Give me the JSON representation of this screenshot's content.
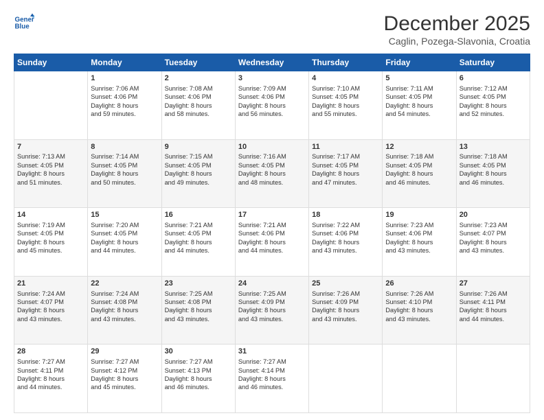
{
  "header": {
    "logo_line1": "General",
    "logo_line2": "Blue",
    "title": "December 2025",
    "subtitle": "Caglin, Pozega-Slavonia, Croatia"
  },
  "weekdays": [
    "Sunday",
    "Monday",
    "Tuesday",
    "Wednesday",
    "Thursday",
    "Friday",
    "Saturday"
  ],
  "weeks": [
    [
      {
        "day": null,
        "info": null
      },
      {
        "day": "1",
        "info": "Sunrise: 7:06 AM\nSunset: 4:06 PM\nDaylight: 8 hours\nand 59 minutes."
      },
      {
        "day": "2",
        "info": "Sunrise: 7:08 AM\nSunset: 4:06 PM\nDaylight: 8 hours\nand 58 minutes."
      },
      {
        "day": "3",
        "info": "Sunrise: 7:09 AM\nSunset: 4:06 PM\nDaylight: 8 hours\nand 56 minutes."
      },
      {
        "day": "4",
        "info": "Sunrise: 7:10 AM\nSunset: 4:05 PM\nDaylight: 8 hours\nand 55 minutes."
      },
      {
        "day": "5",
        "info": "Sunrise: 7:11 AM\nSunset: 4:05 PM\nDaylight: 8 hours\nand 54 minutes."
      },
      {
        "day": "6",
        "info": "Sunrise: 7:12 AM\nSunset: 4:05 PM\nDaylight: 8 hours\nand 52 minutes."
      }
    ],
    [
      {
        "day": "7",
        "info": "Sunrise: 7:13 AM\nSunset: 4:05 PM\nDaylight: 8 hours\nand 51 minutes."
      },
      {
        "day": "8",
        "info": "Sunrise: 7:14 AM\nSunset: 4:05 PM\nDaylight: 8 hours\nand 50 minutes."
      },
      {
        "day": "9",
        "info": "Sunrise: 7:15 AM\nSunset: 4:05 PM\nDaylight: 8 hours\nand 49 minutes."
      },
      {
        "day": "10",
        "info": "Sunrise: 7:16 AM\nSunset: 4:05 PM\nDaylight: 8 hours\nand 48 minutes."
      },
      {
        "day": "11",
        "info": "Sunrise: 7:17 AM\nSunset: 4:05 PM\nDaylight: 8 hours\nand 47 minutes."
      },
      {
        "day": "12",
        "info": "Sunrise: 7:18 AM\nSunset: 4:05 PM\nDaylight: 8 hours\nand 46 minutes."
      },
      {
        "day": "13",
        "info": "Sunrise: 7:18 AM\nSunset: 4:05 PM\nDaylight: 8 hours\nand 46 minutes."
      }
    ],
    [
      {
        "day": "14",
        "info": "Sunrise: 7:19 AM\nSunset: 4:05 PM\nDaylight: 8 hours\nand 45 minutes."
      },
      {
        "day": "15",
        "info": "Sunrise: 7:20 AM\nSunset: 4:05 PM\nDaylight: 8 hours\nand 44 minutes."
      },
      {
        "day": "16",
        "info": "Sunrise: 7:21 AM\nSunset: 4:05 PM\nDaylight: 8 hours\nand 44 minutes."
      },
      {
        "day": "17",
        "info": "Sunrise: 7:21 AM\nSunset: 4:06 PM\nDaylight: 8 hours\nand 44 minutes."
      },
      {
        "day": "18",
        "info": "Sunrise: 7:22 AM\nSunset: 4:06 PM\nDaylight: 8 hours\nand 43 minutes."
      },
      {
        "day": "19",
        "info": "Sunrise: 7:23 AM\nSunset: 4:06 PM\nDaylight: 8 hours\nand 43 minutes."
      },
      {
        "day": "20",
        "info": "Sunrise: 7:23 AM\nSunset: 4:07 PM\nDaylight: 8 hours\nand 43 minutes."
      }
    ],
    [
      {
        "day": "21",
        "info": "Sunrise: 7:24 AM\nSunset: 4:07 PM\nDaylight: 8 hours\nand 43 minutes."
      },
      {
        "day": "22",
        "info": "Sunrise: 7:24 AM\nSunset: 4:08 PM\nDaylight: 8 hours\nand 43 minutes."
      },
      {
        "day": "23",
        "info": "Sunrise: 7:25 AM\nSunset: 4:08 PM\nDaylight: 8 hours\nand 43 minutes."
      },
      {
        "day": "24",
        "info": "Sunrise: 7:25 AM\nSunset: 4:09 PM\nDaylight: 8 hours\nand 43 minutes."
      },
      {
        "day": "25",
        "info": "Sunrise: 7:26 AM\nSunset: 4:09 PM\nDaylight: 8 hours\nand 43 minutes."
      },
      {
        "day": "26",
        "info": "Sunrise: 7:26 AM\nSunset: 4:10 PM\nDaylight: 8 hours\nand 43 minutes."
      },
      {
        "day": "27",
        "info": "Sunrise: 7:26 AM\nSunset: 4:11 PM\nDaylight: 8 hours\nand 44 minutes."
      }
    ],
    [
      {
        "day": "28",
        "info": "Sunrise: 7:27 AM\nSunset: 4:11 PM\nDaylight: 8 hours\nand 44 minutes."
      },
      {
        "day": "29",
        "info": "Sunrise: 7:27 AM\nSunset: 4:12 PM\nDaylight: 8 hours\nand 45 minutes."
      },
      {
        "day": "30",
        "info": "Sunrise: 7:27 AM\nSunset: 4:13 PM\nDaylight: 8 hours\nand 46 minutes."
      },
      {
        "day": "31",
        "info": "Sunrise: 7:27 AM\nSunset: 4:14 PM\nDaylight: 8 hours\nand 46 minutes."
      },
      {
        "day": null,
        "info": null
      },
      {
        "day": null,
        "info": null
      },
      {
        "day": null,
        "info": null
      }
    ]
  ]
}
